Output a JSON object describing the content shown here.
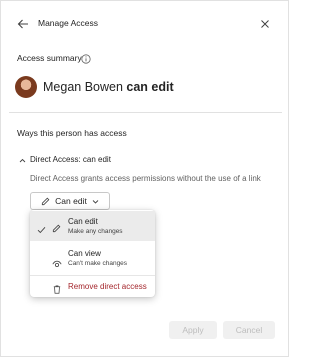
{
  "header": {
    "title": "Manage Access",
    "back_icon": "arrow-left-icon",
    "close_icon": "close-icon"
  },
  "summary": {
    "label": "Access summary",
    "info_icon": "info-icon",
    "user_name": "Megan Bowen",
    "user_permission": "can edit"
  },
  "ways": {
    "heading": "Ways this person has access",
    "direct_access": {
      "title": "Direct Access: can edit",
      "description": "Direct Access grants access permissions without the use of a link",
      "permission_button_label": "Can edit"
    }
  },
  "permission_menu": {
    "items": [
      {
        "title": "Can edit",
        "subtitle": "Make any changes",
        "selected": true,
        "icon": "pencil-icon"
      },
      {
        "title": "Can view",
        "subtitle": "Can't make changes",
        "selected": false,
        "icon": "eye-icon"
      },
      {
        "title": "Remove direct access",
        "icon": "trash-icon"
      }
    ]
  },
  "footer": {
    "apply_label": "Apply",
    "cancel_label": "Cancel"
  },
  "colors": {
    "danger": "#a4262c",
    "divider": "#e1e1e1",
    "selected_bg": "#ebebeb"
  }
}
